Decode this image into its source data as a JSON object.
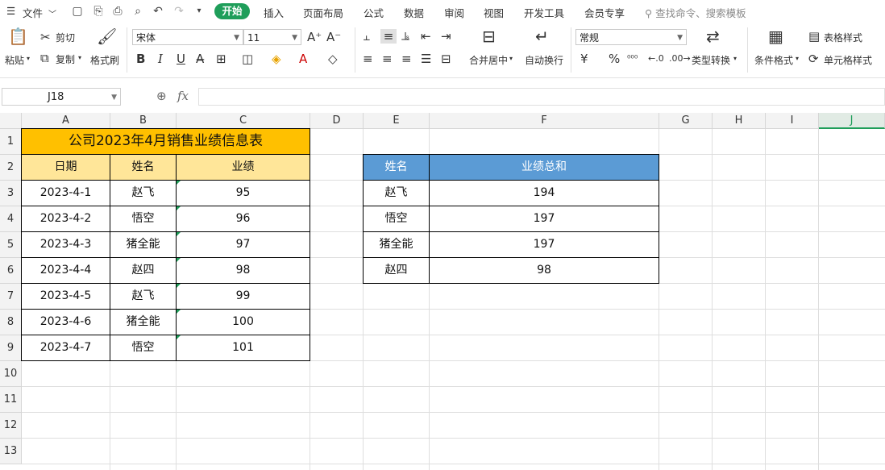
{
  "menubar": {
    "file_label": "文件",
    "tabs": [
      "开始",
      "插入",
      "页面布局",
      "公式",
      "数据",
      "审阅",
      "视图",
      "开发工具",
      "会员专享"
    ],
    "active_tab": "开始",
    "search_placeholder": "查找命令、搜索模板"
  },
  "ribbon": {
    "paste": "粘贴",
    "cut": "剪切",
    "copy": "复制",
    "format_painter": "格式刷",
    "font_name": "宋体",
    "font_size": "11",
    "merge_center": "合并居中",
    "wrap_text": "自动换行",
    "number_format": "常规",
    "type_convert": "类型转换",
    "conditional_format": "条件格式",
    "table_style": "表格样式",
    "cell_style": "单元格样式",
    "bold": "B",
    "italic": "I",
    "underline": "U",
    "currency": "¥",
    "percent": "%"
  },
  "formula_bar": {
    "cell_ref": "J18",
    "fx": "fx",
    "formula": ""
  },
  "columns": [
    "A",
    "B",
    "C",
    "D",
    "E",
    "F",
    "G",
    "H",
    "I",
    "J"
  ],
  "selected_column": "J",
  "rows": [
    "1",
    "2",
    "3",
    "4",
    "5",
    "6",
    "7",
    "8",
    "9",
    "10",
    "11",
    "12",
    "13"
  ],
  "table1": {
    "title": "公司2023年4月销售业绩信息表",
    "headers": [
      "日期",
      "姓名",
      "业绩"
    ],
    "rows": [
      [
        "2023-4-1",
        "赵飞",
        "95"
      ],
      [
        "2023-4-2",
        "悟空",
        "96"
      ],
      [
        "2023-4-3",
        "猪全能",
        "97"
      ],
      [
        "2023-4-4",
        "赵四",
        "98"
      ],
      [
        "2023-4-5",
        "赵飞",
        "99"
      ],
      [
        "2023-4-6",
        "猪全能",
        "100"
      ],
      [
        "2023-4-7",
        "悟空",
        "101"
      ]
    ]
  },
  "table2": {
    "headers": [
      "姓名",
      "业绩总和"
    ],
    "rows": [
      [
        "赵飞",
        "194"
      ],
      [
        "悟空",
        "197"
      ],
      [
        "猪全能",
        "197"
      ],
      [
        "赵四",
        "98"
      ]
    ]
  },
  "colors": {
    "accent": "#1f9e5a",
    "title_fill": "#ffc000",
    "header_yellow": "#ffe699",
    "header_blue": "#5b9bd5"
  }
}
